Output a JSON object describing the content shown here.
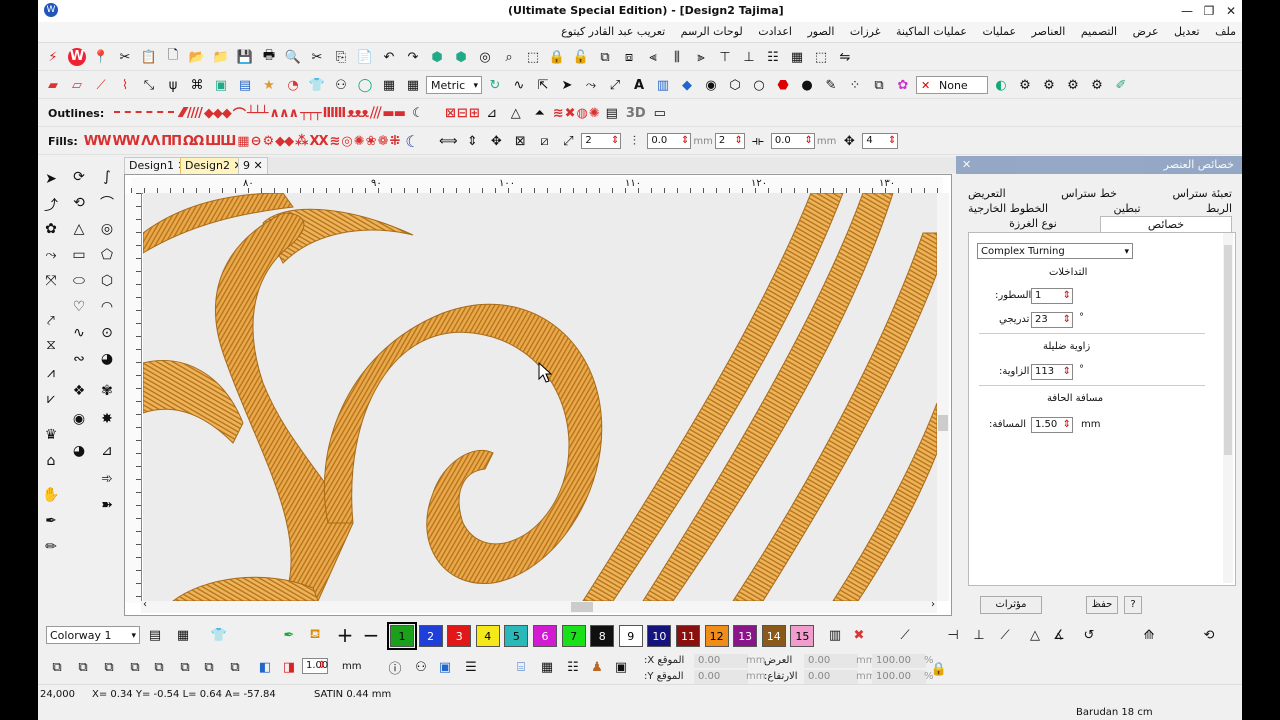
{
  "window": {
    "title": "Tajima]   (Ultimate Special Edition) - [Design2",
    "title_display": "(Ultimate Special Edition) - [Design2          Tajima]"
  },
  "menu": [
    "ملف",
    "تعديل",
    "عرض",
    "التصميم",
    "العناصر",
    "عمليات",
    "عمليات الماكينة",
    "غرزات",
    "الصور",
    "اعدادت",
    "لوحات الرسم",
    "تعريب عبد القادر كيتوع"
  ],
  "toolbar2": {
    "units": "Metric",
    "none_label": "None"
  },
  "toolbar3": {
    "outlines_label": "Outlines:",
    "threed": "3D"
  },
  "toolbar4": {
    "fills_label": "Fills:",
    "v1": "2",
    "v2": "0.0",
    "v3": "2",
    "v4": "0.0",
    "unit1": "mm",
    "unit2": "mm",
    "v5": "4"
  },
  "doc_tabs": [
    {
      "label": "Design1"
    },
    {
      "label": "Design2"
    },
    {
      "label": "9"
    }
  ],
  "ruler": {
    "ticks": [
      "٨٠",
      "٩٠",
      "١٠٠",
      "١١٠",
      "١٢٠",
      "١٣٠"
    ]
  },
  "panel": {
    "title": "خصائص العنصر",
    "tabs_row1": [
      "تعبئة ستراس",
      "خط ستراس",
      "التعريض"
    ],
    "tabs_row2": [
      "الربط",
      "تبطين",
      "الخطوط الخارجية"
    ],
    "prop_tab_active": "خصائص",
    "prop_tab_other": "نوع الغرزة",
    "stitch_type": "Complex Turning",
    "group1": "التداخلات",
    "lines_label": "السطور:",
    "lines_value": "1",
    "gradient_label": "تدريجي",
    "gradient_value": "23",
    "deg1": "°",
    "group2": "زاوية ضليلة",
    "angle_label": "الزاوية:",
    "angle_value": "113",
    "deg2": "°",
    "group3": "مسافة الحافة",
    "distance_label": "المسافة:",
    "distance_value": "1.50",
    "distance_unit": "mm",
    "btn_effects": "مؤثرات",
    "btn_save": "حفظ",
    "btn_help": "?"
  },
  "colorbar": {
    "colorway": "Colorway 1",
    "swatches": [
      {
        "n": "1",
        "color": "#1aa01a",
        "fg": "#000"
      },
      {
        "n": "2",
        "color": "#1e3fd8",
        "fg": "#fff"
      },
      {
        "n": "3",
        "color": "#e01818",
        "fg": "#fff"
      },
      {
        "n": "4",
        "color": "#f4e81a",
        "fg": "#000"
      },
      {
        "n": "5",
        "color": "#2bb8b8",
        "fg": "#000"
      },
      {
        "n": "6",
        "color": "#d21ad2",
        "fg": "#fff"
      },
      {
        "n": "7",
        "color": "#1ae01a",
        "fg": "#000"
      },
      {
        "n": "8",
        "color": "#101010",
        "fg": "#fff"
      },
      {
        "n": "9",
        "color": "#ffffff",
        "fg": "#000"
      },
      {
        "n": "10",
        "color": "#14147c",
        "fg": "#fff"
      },
      {
        "n": "11",
        "color": "#8a1010",
        "fg": "#fff"
      },
      {
        "n": "12",
        "color": "#f08c18",
        "fg": "#000"
      },
      {
        "n": "13",
        "color": "#8a148a",
        "fg": "#fff"
      },
      {
        "n": "14",
        "color": "#8a5a1a",
        "fg": "#fff"
      },
      {
        "n": "15",
        "color": "#f09ccc",
        "fg": "#000"
      }
    ]
  },
  "coords": {
    "pen_value": "1.00",
    "pen_unit": "mm",
    "x_label": "الموقع X:",
    "y_label": "الموقع Y:",
    "x_val": "0.00",
    "y_val": "0.00",
    "unit": "mm",
    "w_label": "العرض",
    "h_label": "الارتفاع:",
    "w_val": "0.00",
    "h_val": "0.00",
    "wp": "100.00",
    "hp": "100.00",
    "pct": "%"
  },
  "status": {
    "stitches": "24,000",
    "xy": "X=  0.34 Y=  -0.54 L=  0.64 A= -57.84",
    "satin": "SATIN  0.44 mm",
    "machine": "Barudan 18 cm"
  },
  "accent": {
    "thread": "#e7a53e",
    "thread_dark": "#b8741c",
    "panel_header": "#4a6fa5"
  }
}
